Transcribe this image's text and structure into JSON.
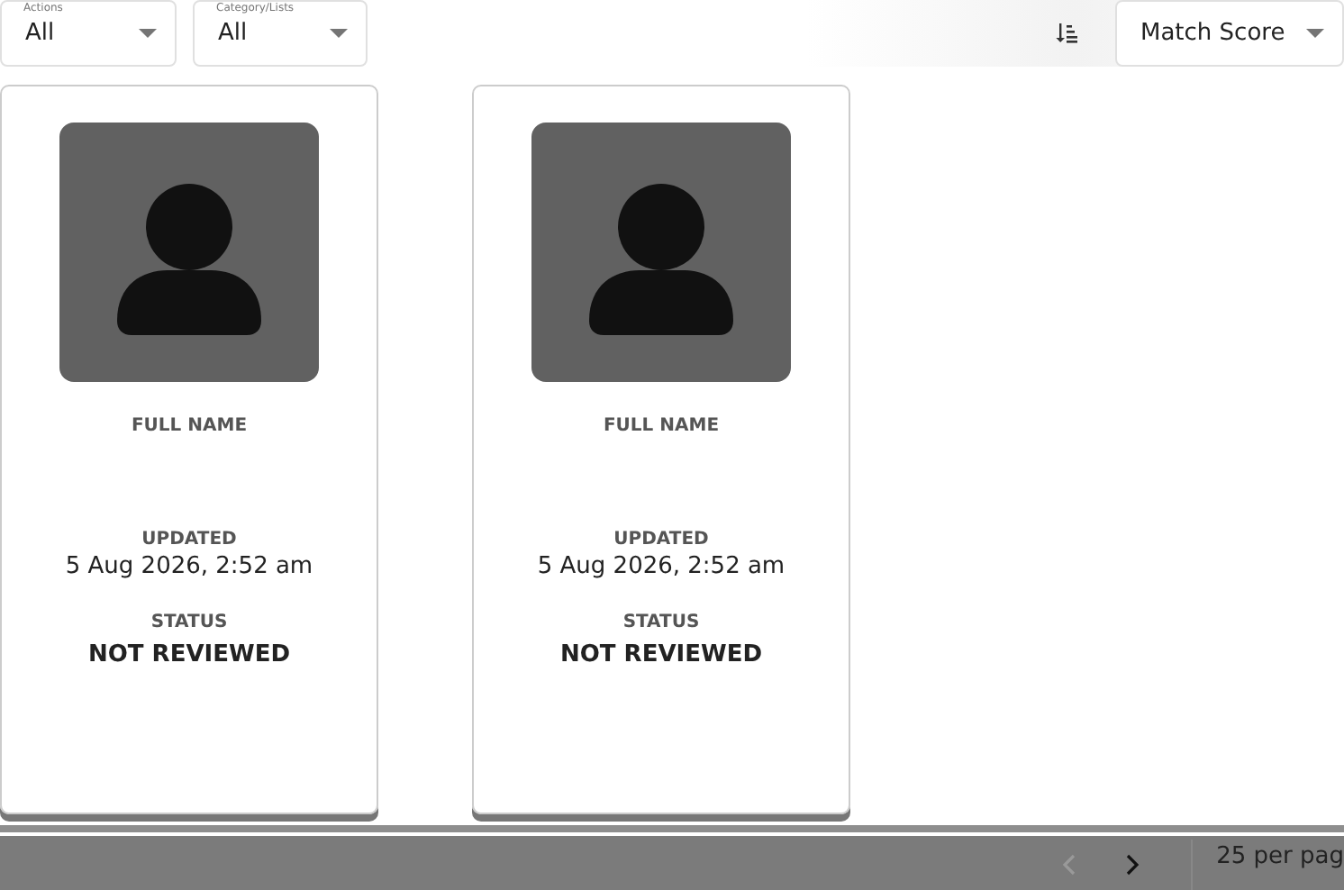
{
  "filters": [
    {
      "label": "Actions",
      "value": "All"
    },
    {
      "label": "Category/Lists",
      "value": "All"
    }
  ],
  "sort": {
    "value": "Match Score"
  },
  "cards": [
    {
      "name_label": "FULL NAME",
      "updated_label": "UPDATED",
      "updated": "5 Aug 2026, 2:52 am",
      "status_label": "STATUS",
      "status": "NOT REVIEWED"
    },
    {
      "name_label": "FULL NAME",
      "updated_label": "UPDATED",
      "updated": "5 Aug 2026, 2:52 am",
      "status_label": "STATUS",
      "status": "NOT REVIEWED"
    }
  ],
  "pagination": {
    "prev_disabled": true,
    "next_disabled": false,
    "per_page": "25 per pag"
  }
}
